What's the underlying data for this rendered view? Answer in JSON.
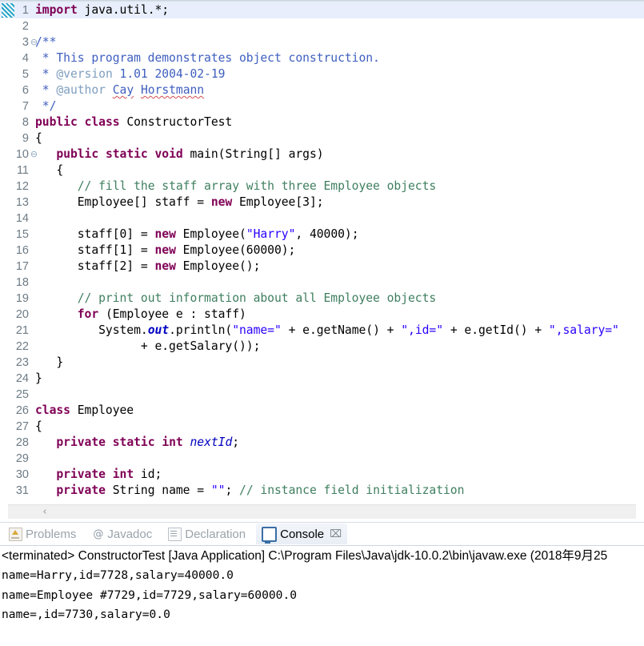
{
  "editor": {
    "current_line": 1,
    "colors": {
      "keyword": "#7f0055",
      "string": "#2a00ff",
      "comment": "#3f7f5f",
      "javadoc": "#3f5fbf",
      "javadoc_tag": "#7f9fbf",
      "field": "#0000c0",
      "current_line_bg": "#e8eefb",
      "line_number": "#6d7b86"
    },
    "lines": [
      {
        "n": "1",
        "fold": "",
        "current": true,
        "text": "import java.util.*;"
      },
      {
        "n": "2",
        "fold": "",
        "current": false,
        "text": ""
      },
      {
        "n": "3",
        "fold": "⊖",
        "current": false,
        "text": "/**"
      },
      {
        "n": "4",
        "fold": "",
        "current": false,
        "text": " * This program demonstrates object construction."
      },
      {
        "n": "5",
        "fold": "",
        "current": false,
        "text": " * @version 1.01 2004-02-19"
      },
      {
        "n": "6",
        "fold": "",
        "current": false,
        "text": " * @author Cay Horstmann"
      },
      {
        "n": "7",
        "fold": "",
        "current": false,
        "text": " */"
      },
      {
        "n": "8",
        "fold": "",
        "current": false,
        "text": "public class ConstructorTest"
      },
      {
        "n": "9",
        "fold": "",
        "current": false,
        "text": "{"
      },
      {
        "n": "10",
        "fold": "⊖",
        "current": false,
        "text": "   public static void main(String[] args)"
      },
      {
        "n": "11",
        "fold": "",
        "current": false,
        "text": "   {"
      },
      {
        "n": "12",
        "fold": "",
        "current": false,
        "text": "      // fill the staff array with three Employee objects"
      },
      {
        "n": "13",
        "fold": "",
        "current": false,
        "text": "      Employee[] staff = new Employee[3];"
      },
      {
        "n": "14",
        "fold": "",
        "current": false,
        "text": ""
      },
      {
        "n": "15",
        "fold": "",
        "current": false,
        "text": "      staff[0] = new Employee(\"Harry\", 40000);"
      },
      {
        "n": "16",
        "fold": "",
        "current": false,
        "text": "      staff[1] = new Employee(60000);"
      },
      {
        "n": "17",
        "fold": "",
        "current": false,
        "text": "      staff[2] = new Employee();"
      },
      {
        "n": "18",
        "fold": "",
        "current": false,
        "text": ""
      },
      {
        "n": "19",
        "fold": "",
        "current": false,
        "text": "      // print out information about all Employee objects"
      },
      {
        "n": "20",
        "fold": "",
        "current": false,
        "text": "      for (Employee e : staff)"
      },
      {
        "n": "21",
        "fold": "",
        "current": false,
        "text": "         System.out.println(\"name=\" + e.getName() + \",id=\" + e.getId() + \",salary=\""
      },
      {
        "n": "22",
        "fold": "",
        "current": false,
        "text": "               + e.getSalary());"
      },
      {
        "n": "23",
        "fold": "",
        "current": false,
        "text": "   }"
      },
      {
        "n": "24",
        "fold": "",
        "current": false,
        "text": "}"
      },
      {
        "n": "25",
        "fold": "",
        "current": false,
        "text": ""
      },
      {
        "n": "26",
        "fold": "",
        "current": false,
        "text": "class Employee"
      },
      {
        "n": "27",
        "fold": "",
        "current": false,
        "text": "{"
      },
      {
        "n": "28",
        "fold": "",
        "current": false,
        "text": "   private static int nextId;"
      },
      {
        "n": "29",
        "fold": "",
        "current": false,
        "text": ""
      },
      {
        "n": "30",
        "fold": "",
        "current": false,
        "text": "   private int id;"
      },
      {
        "n": "31",
        "fold": "",
        "current": false,
        "text": "   private String name = \"\"; // instance field initialization"
      }
    ],
    "scrollbar": {
      "left_arrow": "‹"
    }
  },
  "bottom_panel": {
    "tabs": [
      {
        "label": "Problems",
        "icon": "problems-icon",
        "active": false,
        "closable": false
      },
      {
        "label": "Javadoc",
        "icon": "javadoc-icon",
        "active": false,
        "closable": false
      },
      {
        "label": "Declaration",
        "icon": "declaration-icon",
        "active": false,
        "closable": false
      },
      {
        "label": "Console",
        "icon": "console-icon",
        "active": true,
        "closable": true,
        "close_glyph": "⌧"
      }
    ],
    "console": {
      "terminated_line": "<terminated> ConstructorTest [Java Application] C:\\Program Files\\Java\\jdk-10.0.2\\bin\\javaw.exe (2018年9月25",
      "output": "name=Harry,id=7728,salary=40000.0\nname=Employee #7729,id=7729,salary=60000.0\nname=,id=7730,salary=0.0"
    }
  }
}
